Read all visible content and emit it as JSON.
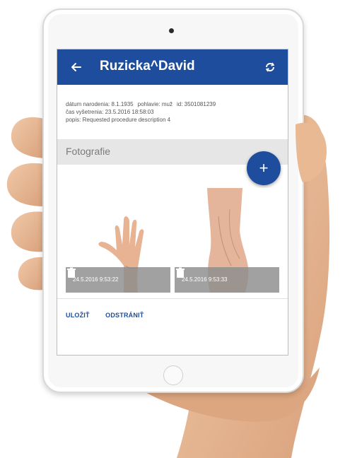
{
  "app": {
    "title": "Ruzicka^David"
  },
  "patient": {
    "birth_date": "dátum narodenia: 8.1.1935",
    "sex": "pohlavie: muž",
    "id": "id: 3501081239",
    "exam_time": "čas vyšetrenia: 23.5.2016 18:58:03",
    "description": "popis: Requested procedure description 4"
  },
  "section": {
    "title": "Fotografie"
  },
  "fab": {
    "label": "+"
  },
  "photos": [
    {
      "timestamp": "24.5.2016 9:53:22"
    },
    {
      "timestamp": "24.5.2016 9:53:33"
    }
  ],
  "actions": {
    "save_label": "ULOŽIŤ",
    "remove_label": "ODSTRÁNIŤ"
  },
  "icons": {
    "back": "arrow-left-icon",
    "sync": "sync-icon",
    "delete": "trash-icon"
  },
  "colors": {
    "primary": "#1d4d9c",
    "section_bg": "#e6e6e6",
    "caption_bg": "#8c8c8c"
  }
}
